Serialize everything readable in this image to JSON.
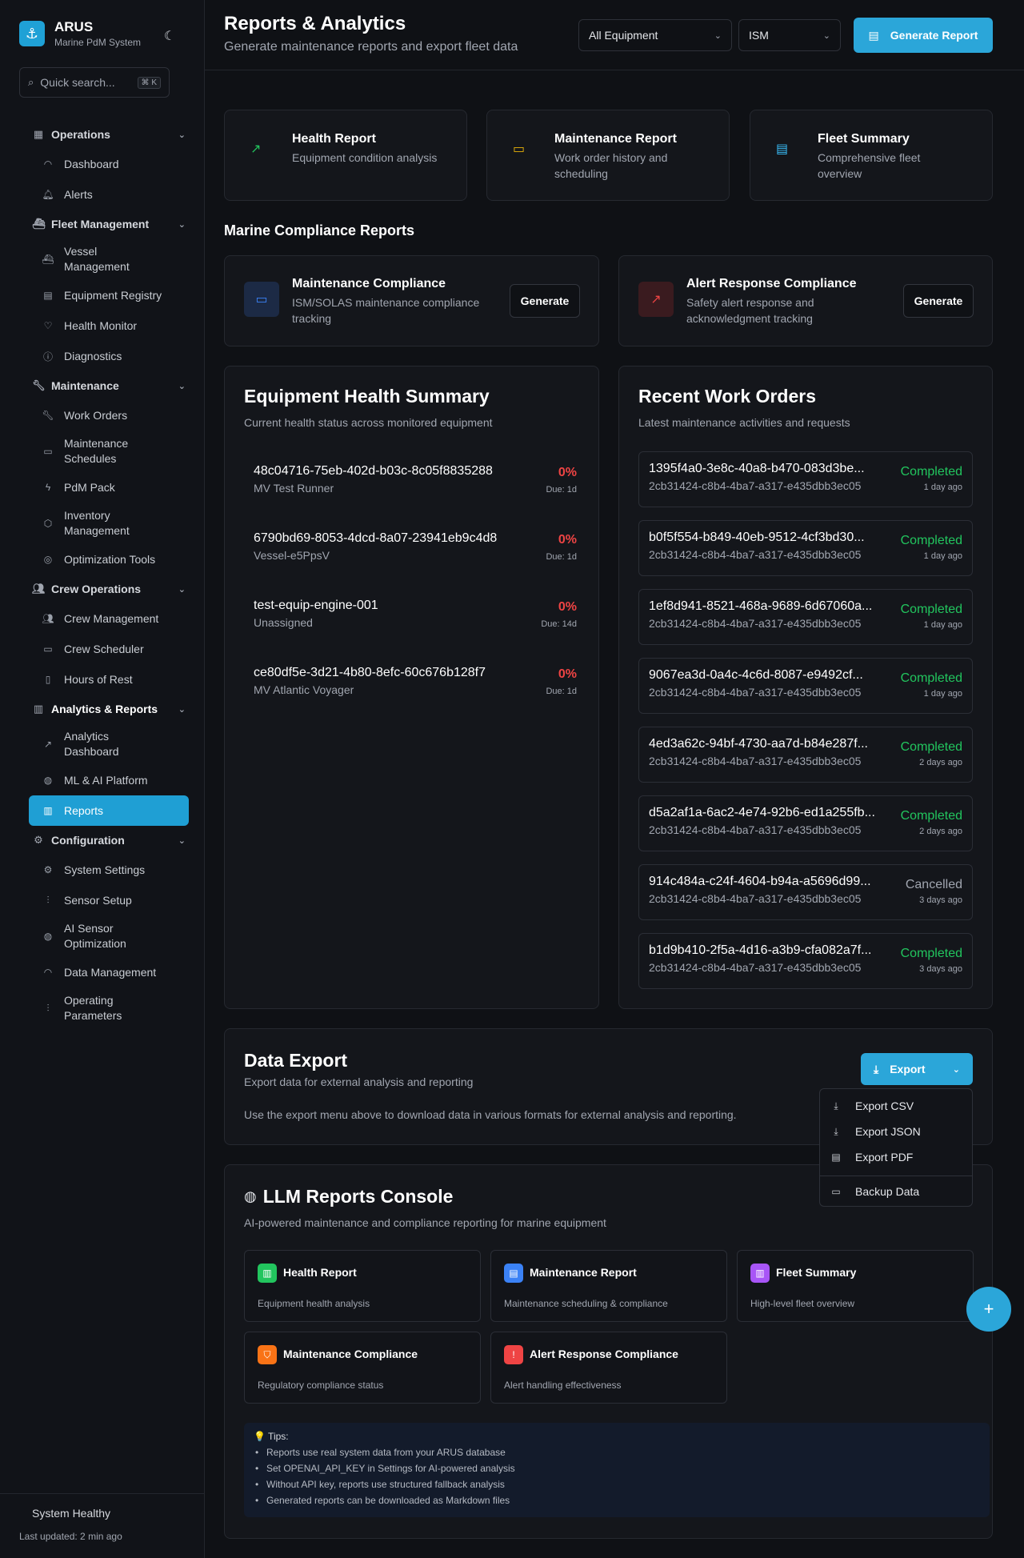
{
  "brand": {
    "title": "ARUS",
    "subtitle": "Marine PdM System"
  },
  "search": {
    "placeholder": "Quick search...",
    "shortcut": "⌘ K"
  },
  "nav": {
    "operations": {
      "label": "Operations",
      "items": [
        "Dashboard",
        "Alerts"
      ]
    },
    "fleet": {
      "label": "Fleet Management",
      "items": [
        "Vessel Management",
        "Equipment Registry",
        "Health Monitor",
        "Diagnostics"
      ]
    },
    "maintenance": {
      "label": "Maintenance",
      "items": [
        "Work Orders",
        "Maintenance Schedules",
        "PdM Pack",
        "Inventory Management",
        "Optimization Tools"
      ]
    },
    "crew": {
      "label": "Crew Operations",
      "items": [
        "Crew Management",
        "Crew Scheduler",
        "Hours of Rest"
      ]
    },
    "analytics": {
      "label": "Analytics & Reports",
      "items": [
        "Analytics Dashboard",
        "ML & AI Platform",
        "Reports"
      ]
    },
    "config": {
      "label": "Configuration",
      "items": [
        "System Settings",
        "Sensor Setup",
        "AI Sensor Optimization",
        "Data Management",
        "Operating Parameters"
      ]
    }
  },
  "footer": {
    "status": "System Healthy",
    "updated": "Last updated: 2 min ago"
  },
  "header": {
    "title": "Reports & Analytics",
    "subtitle": "Generate maintenance reports and export fleet data",
    "equipment_select": "All Equipment",
    "standard_select": "ISM",
    "generate_label": "Generate Report"
  },
  "report_types": [
    {
      "title": "Health Report",
      "desc": "Equipment condition analysis",
      "icon": "trending-up-icon",
      "color": "#22c55e"
    },
    {
      "title": "Maintenance Report",
      "desc": "Work order history and scheduling",
      "icon": "calendar-icon",
      "color": "#eab308"
    },
    {
      "title": "Fleet Summary",
      "desc": "Comprehensive fleet overview",
      "icon": "document-icon",
      "color": "#38bdf8"
    }
  ],
  "compliance": {
    "heading": "Marine Compliance Reports",
    "cards": [
      {
        "title": "Maintenance Compliance",
        "desc": "ISM/SOLAS maintenance compliance tracking",
        "button": "Generate",
        "color": "#3b82f6"
      },
      {
        "title": "Alert Response Compliance",
        "desc": "Safety alert response and acknowledgment tracking",
        "button": "Generate",
        "color": "#ef4444"
      }
    ]
  },
  "health_summary": {
    "title": "Equipment Health Summary",
    "subtitle": "Current health status across monitored equipment",
    "items": [
      {
        "id": "48c04716-75eb-402d-b03c-8c05f8835288",
        "vessel": "MV Test Runner",
        "pct": "0%",
        "due": "Due: 1d"
      },
      {
        "id": "6790bd69-8053-4dcd-8a07-23941eb9c4d8",
        "vessel": "Vessel-e5PpsV",
        "pct": "0%",
        "due": "Due: 1d"
      },
      {
        "id": "test-equip-engine-001",
        "vessel": "Unassigned",
        "pct": "0%",
        "due": "Due: 14d"
      },
      {
        "id": "ce80df5e-3d21-4b80-8efc-60c676b128f7",
        "vessel": "MV Atlantic Voyager",
        "pct": "0%",
        "due": "Due: 1d"
      }
    ]
  },
  "work_orders": {
    "title": "Recent Work Orders",
    "subtitle": "Latest maintenance activities and requests",
    "items": [
      {
        "id": "1395f4a0-3e8c-40a8-b470-083d3be...",
        "equip": "2cb31424-c8b4-4ba7-a317-e435dbb3ec05",
        "status": "Completed",
        "time": "1 day ago"
      },
      {
        "id": "b0f5f554-b849-40eb-9512-4cf3bd30...",
        "equip": "2cb31424-c8b4-4ba7-a317-e435dbb3ec05",
        "status": "Completed",
        "time": "1 day ago"
      },
      {
        "id": "1ef8d941-8521-468a-9689-6d67060a...",
        "equip": "2cb31424-c8b4-4ba7-a317-e435dbb3ec05",
        "status": "Completed",
        "time": "1 day ago"
      },
      {
        "id": "9067ea3d-0a4c-4c6d-8087-e9492cf...",
        "equip": "2cb31424-c8b4-4ba7-a317-e435dbb3ec05",
        "status": "Completed",
        "time": "1 day ago"
      },
      {
        "id": "4ed3a62c-94bf-4730-aa7d-b84e287f...",
        "equip": "2cb31424-c8b4-4ba7-a317-e435dbb3ec05",
        "status": "Completed",
        "time": "2 days ago"
      },
      {
        "id": "d5a2af1a-6ac2-4e74-92b6-ed1a255fb...",
        "equip": "2cb31424-c8b4-4ba7-a317-e435dbb3ec05",
        "status": "Completed",
        "time": "2 days ago"
      },
      {
        "id": "914c484a-c24f-4604-b94a-a5696d99...",
        "equip": "2cb31424-c8b4-4ba7-a317-e435dbb3ec05",
        "status": "Cancelled",
        "time": "3 days ago"
      },
      {
        "id": "b1d9b410-2f5a-4d16-a3b9-cfa082a7f...",
        "equip": "2cb31424-c8b4-4ba7-a317-e435dbb3ec05",
        "status": "Completed",
        "time": "3 days ago"
      }
    ]
  },
  "data_export": {
    "title": "Data Export",
    "subtitle": "Export data for external analysis and reporting",
    "note": "Use the export menu above to download data in various formats for external analysis and reporting.",
    "button": "Export",
    "menu": [
      "Export CSV",
      "Export JSON",
      "Export PDF",
      "Backup Data"
    ]
  },
  "llm": {
    "title": "LLM Reports Console",
    "subtitle": "AI-powered maintenance and compliance reporting for marine equipment",
    "cards": [
      {
        "title": "Health Report",
        "desc": "Equipment health analysis",
        "color": "#22c55e"
      },
      {
        "title": "Maintenance Report",
        "desc": "Maintenance scheduling & compliance",
        "color": "#3b82f6"
      },
      {
        "title": "Fleet Summary",
        "desc": "High-level fleet overview",
        "color": "#a855f7"
      },
      {
        "title": "Maintenance Compliance",
        "desc": "Regulatory compliance status",
        "color": "#f97316"
      },
      {
        "title": "Alert Response Compliance",
        "desc": "Alert handling effectiveness",
        "color": "#ef4444"
      }
    ],
    "tips_heading": "💡 Tips:",
    "tips": [
      "Reports use real system data from your ARUS database",
      "Set OPENAI_API_KEY in Settings for AI-powered analysis",
      "Without API key, reports use structured fallback analysis",
      "Generated reports can be downloaded as Markdown files"
    ]
  },
  "fab_label": "+"
}
